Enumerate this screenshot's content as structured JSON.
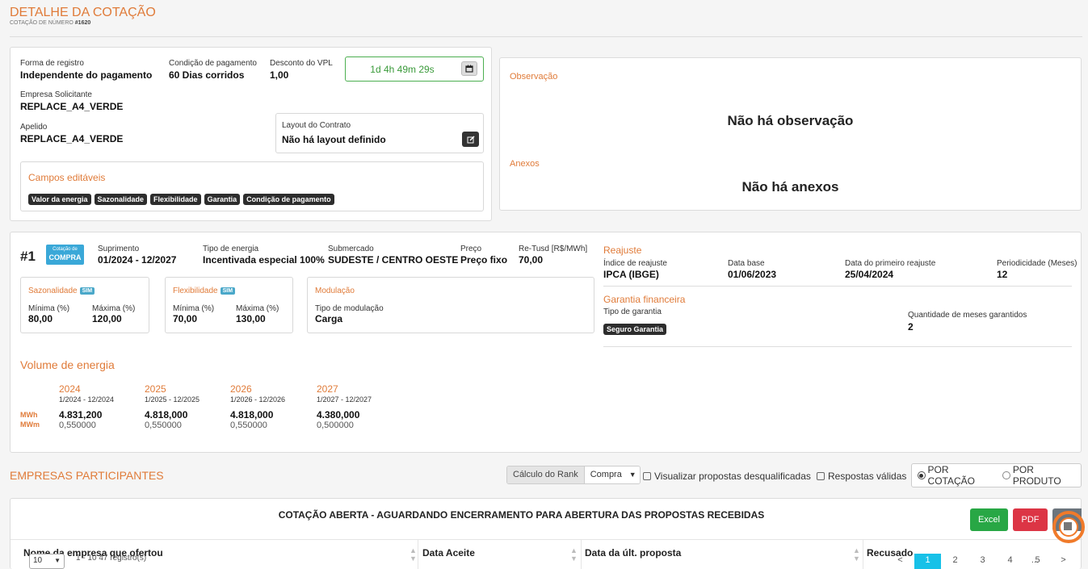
{
  "page": {
    "title": "DETALHE DA COTAÇÃO",
    "subtitle_prefix": "COTAÇÃO DE NÚMERO",
    "number": "#1620"
  },
  "info": {
    "forma_label": "Forma de registro",
    "forma_value": "Independente do pagamento",
    "condicao_label": "Condição de pagamento",
    "condicao_value": "60 Dias corridos",
    "desconto_label": "Desconto do VPL",
    "desconto_value": "1,00",
    "timer": "1d 4h 49m 29s",
    "empresa_label": "Empresa Solicitante",
    "empresa_value": "REPLACE_A4_VERDE",
    "apelido_label": "Apelido",
    "apelido_value": "REPLACE_A4_VERDE",
    "layout_label": "Layout do Contrato",
    "layout_value": "Não há layout definido"
  },
  "editable": {
    "title": "Campos editáveis",
    "badges": [
      "Valor da energia",
      "Sazonalidade",
      "Flexibilidade",
      "Garantia",
      "Condição de pagamento"
    ]
  },
  "obs": {
    "obs_title": "Observação",
    "obs_text": "Não há observação",
    "anexos_title": "Anexos",
    "anexos_text": "Não há anexos"
  },
  "item": {
    "index": "#1",
    "tag_top": "Cotação de",
    "tag_bottom": "COMPRA",
    "suprimento_label": "Suprimento",
    "suprimento_value": "01/2024 - 12/2027",
    "tipo_label": "Tipo de energia",
    "tipo_value": "Incentivada especial 100%",
    "submercado_label": "Submercado",
    "submercado_value": "SUDESTE / CENTRO OESTE",
    "preco_label": "Preço",
    "preco_value": "Preço fixo",
    "retusd_label": "Re-Tusd [R$/MWh]",
    "retusd_value": "70,00"
  },
  "sazonalidade": {
    "title": "Sazonalidade",
    "flag": "SIM",
    "min_label": "Mínima (%)",
    "min_value": "80,00",
    "max_label": "Máxima (%)",
    "max_value": "120,00"
  },
  "flexibilidade": {
    "title": "Flexibilidade",
    "flag": "SIM",
    "min_label": "Mínima (%)",
    "min_value": "70,00",
    "max_label": "Máxima (%)",
    "max_value": "130,00"
  },
  "modulacao": {
    "title": "Modulação",
    "tipo_label": "Tipo de modulação",
    "tipo_value": "Carga"
  },
  "reajuste": {
    "title": "Reajuste",
    "indice_label": "Índice de reajuste",
    "indice_value": "IPCA (IBGE)",
    "base_label": "Data base",
    "base_value": "01/06/2023",
    "primeiro_label": "Data do primeiro reajuste",
    "primeiro_value": "25/04/2024",
    "periodicidade_label": "Periodicidade (Meses)",
    "periodicidade_value": "12"
  },
  "garantia": {
    "title": "Garantia financeira",
    "tipo_label": "Tipo de garantia",
    "tipo_value": "Seguro Garantia",
    "meses_label": "Quantidade de meses garantidos",
    "meses_value": "2"
  },
  "volume": {
    "title": "Volume de energia",
    "unit_mwh": "MWh",
    "unit_mwm": "MWm",
    "years": [
      {
        "year": "2024",
        "period": "1/2024 - 12/2024",
        "mwh": "4.831,200",
        "mwm": "0,550000"
      },
      {
        "year": "2025",
        "period": "1/2025 - 12/2025",
        "mwh": "4.818,000",
        "mwm": "0,550000"
      },
      {
        "year": "2026",
        "period": "1/2026 - 12/2026",
        "mwh": "4.818,000",
        "mwm": "0,550000"
      },
      {
        "year": "2027",
        "period": "1/2027 - 12/2027",
        "mwh": "4.380,000",
        "mwm": "0,500000"
      }
    ]
  },
  "participants": {
    "title": "EMPRESAS PARTICIPANTES",
    "rank_label": "Cálculo do Rank",
    "rank_value": "Compra",
    "chk_desq": "Visualizar propostas desqualificadas",
    "chk_validas": "Respostas válidas",
    "radio_cotacao": "POR COTAÇÃO",
    "radio_produto": "POR PRODUTO",
    "status": "COTAÇÃO ABERTA - AGUARDANDO ENCERRAMENTO PARA ABERTURA DAS PROPOSTAS RECEBIDAS",
    "excel": "Excel",
    "pdf": "PDF",
    "columns": [
      "Nome da empresa que ofertou",
      "Data Aceite",
      "Data da últ. proposta",
      "Recusado"
    ],
    "page_size": "10",
    "records": "1 - 10 47 registro(s)",
    "pages": [
      "<",
      "1",
      "2",
      "3",
      "4",
      "...",
      "5",
      ">"
    ]
  }
}
